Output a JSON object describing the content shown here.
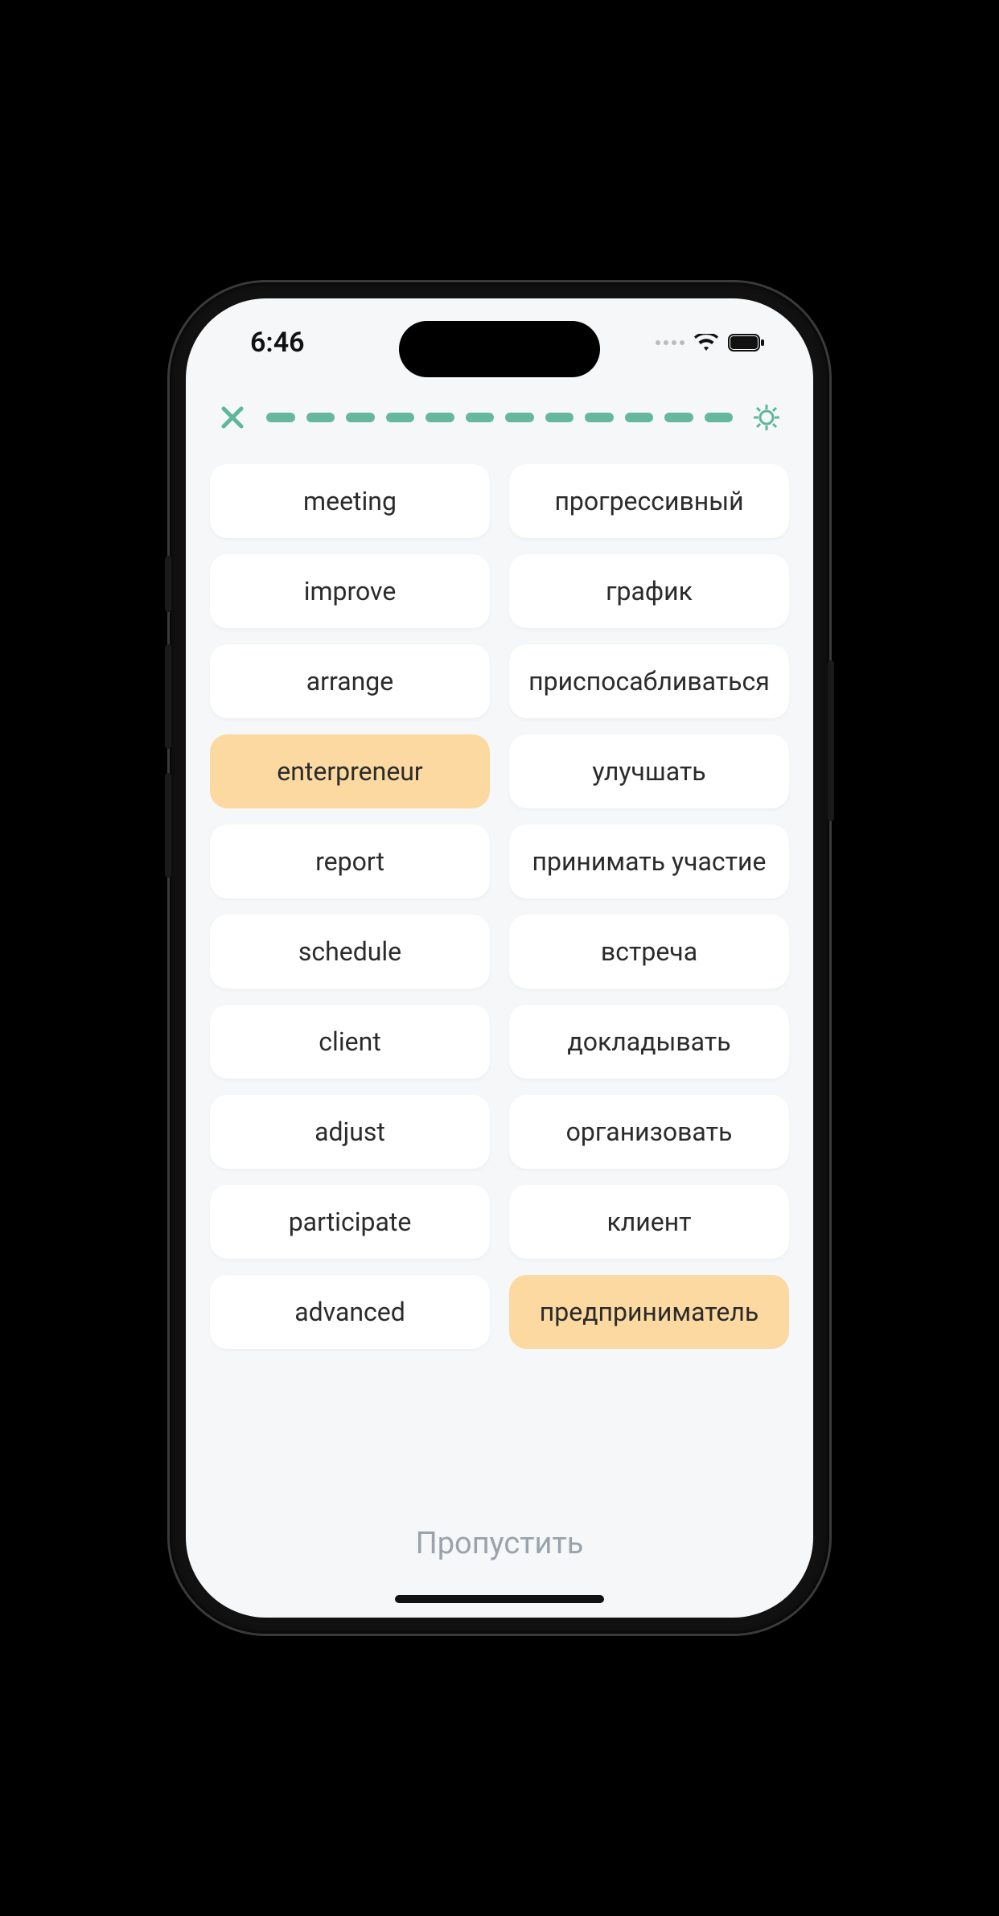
{
  "status": {
    "time": "6:46"
  },
  "progress": {
    "segments": 12
  },
  "left_words": [
    {
      "label": "meeting",
      "selected": false
    },
    {
      "label": "improve",
      "selected": false
    },
    {
      "label": "arrange",
      "selected": false
    },
    {
      "label": "enterpreneur",
      "selected": true
    },
    {
      "label": "report",
      "selected": false
    },
    {
      "label": "schedule",
      "selected": false
    },
    {
      "label": "client",
      "selected": false
    },
    {
      "label": "adjust",
      "selected": false
    },
    {
      "label": "participate",
      "selected": false
    },
    {
      "label": "advanced",
      "selected": false
    }
  ],
  "right_words": [
    {
      "label": "прогрессивный",
      "selected": false
    },
    {
      "label": "график",
      "selected": false
    },
    {
      "label": "приспосабливаться",
      "selected": false
    },
    {
      "label": "улучшать",
      "selected": false
    },
    {
      "label": "принимать участие",
      "selected": false
    },
    {
      "label": "встреча",
      "selected": false
    },
    {
      "label": "докладывать",
      "selected": false
    },
    {
      "label": "организовать",
      "selected": false
    },
    {
      "label": "клиент",
      "selected": false
    },
    {
      "label": "предприниматель",
      "selected": true
    }
  ],
  "skip_label": "Пропустить",
  "colors": {
    "accent": "#66b89c",
    "selected": "#fcd9a0"
  }
}
